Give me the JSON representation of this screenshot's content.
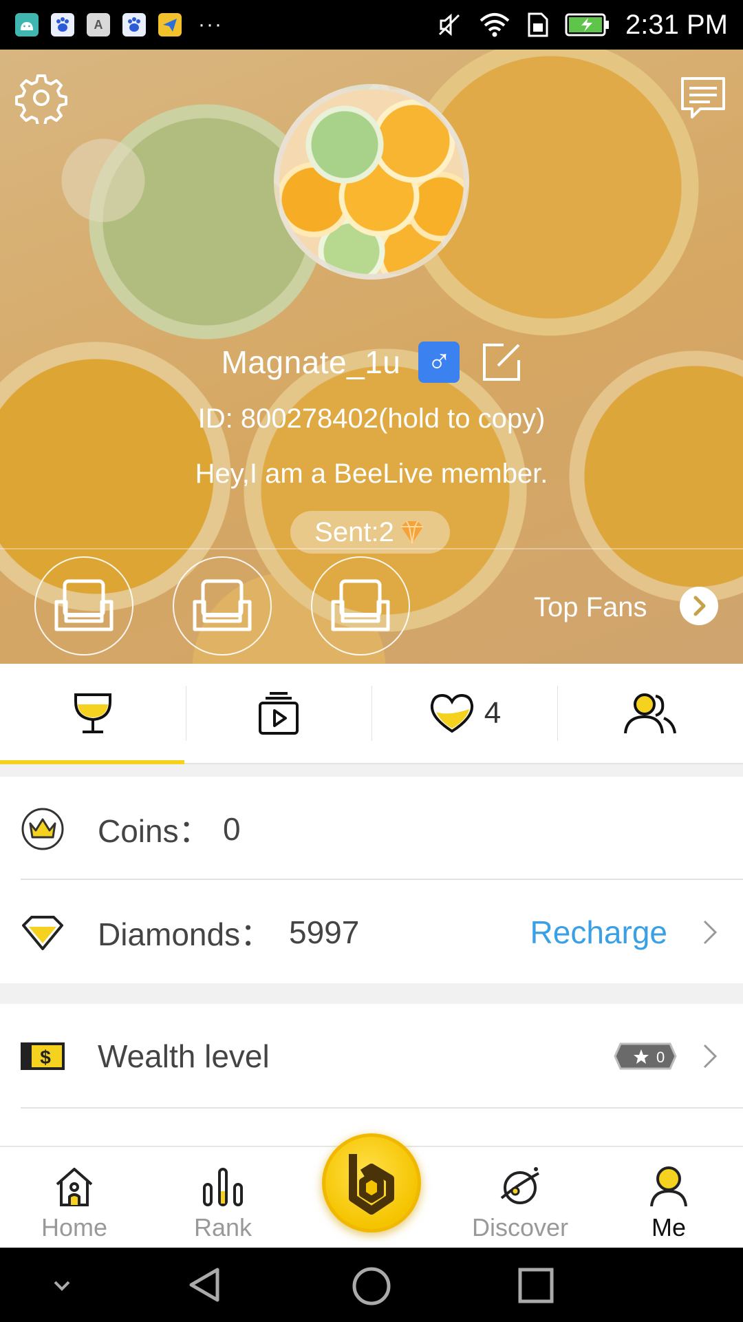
{
  "status_bar": {
    "time": "2:31 PM",
    "dots": "···",
    "app_icons": [
      "android-icon",
      "baidu-paw-icon",
      "font-a-icon",
      "baidu-paw-icon",
      "paper-plane-icon"
    ],
    "system_icons": [
      "mute-icon",
      "wifi-icon",
      "sim-icon",
      "battery-charging-icon"
    ],
    "app_icon_a_text": "A"
  },
  "profile": {
    "username": "Magnate_1u",
    "gender_symbol": "♂",
    "id_line": "ID: 800278402(hold to copy)",
    "bio": "Hey,I am a BeeLive member.",
    "sent_label": "Sent:2",
    "top_fans_label": "Top Fans"
  },
  "tabs": [
    {
      "name": "trophy",
      "icon": "trophy-icon"
    },
    {
      "name": "videos",
      "icon": "video-stack-icon"
    },
    {
      "name": "likes",
      "icon": "heart-icon",
      "count": "4"
    },
    {
      "name": "friends",
      "icon": "people-icon"
    }
  ],
  "wallet": {
    "coins_label": "Coins：",
    "coins_value": "0",
    "diamonds_label": "Diamonds：",
    "diamonds_value": "5997",
    "recharge_label": "Recharge"
  },
  "levels": {
    "wealth_label": "Wealth level",
    "wealth_badge_value": "0"
  },
  "bottom_nav": {
    "home": "Home",
    "rank": "Rank",
    "discover": "Discover",
    "me": "Me"
  },
  "colors": {
    "accent_yellow": "#f5d21f",
    "recharge_blue": "#3aa0e6",
    "gender_blue": "#3b82f0"
  }
}
